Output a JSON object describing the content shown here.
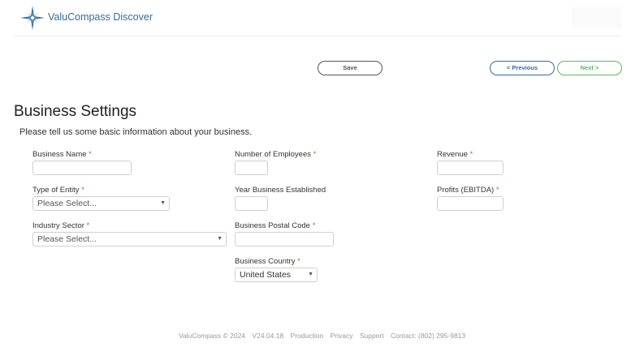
{
  "header": {
    "app_name": "ValuCompass Discover"
  },
  "toolbar": {
    "save_label": "Save",
    "previous_label": "< Previous",
    "next_label": "Next >"
  },
  "page": {
    "title": "Business Settings",
    "intro": "Please tell us some basic information about your business."
  },
  "required_marker": "*",
  "fields": {
    "business_name": {
      "label": "Business Name",
      "value": ""
    },
    "num_employees": {
      "label": "Number of Employees",
      "value": ""
    },
    "revenue": {
      "label": "Revenue",
      "value": ""
    },
    "entity_type": {
      "label": "Type of Entity",
      "value": "Please Select..."
    },
    "year_established": {
      "label": "Year Business Established",
      "value": ""
    },
    "profits": {
      "label": "Profits (EBITDA)",
      "value": ""
    },
    "industry_sector": {
      "label": "Industry Sector",
      "value": "Please Select..."
    },
    "postal_code": {
      "label": "Business Postal Code",
      "value": ""
    },
    "country": {
      "label": "Business Country",
      "value": "United States"
    }
  },
  "footer": {
    "copyright": "ValuCompass © 2024",
    "version": "V24.04.18",
    "environment": "Production",
    "privacy": "Privacy",
    "support": "Support",
    "contact": "Contact: (802) 295-9813"
  },
  "colors": {
    "brand": "#2e6da4",
    "next": "#5cb85c",
    "required": "#d9534f"
  },
  "icons": {
    "logo": "compass-star-icon",
    "select_arrow": "caret-down-icon"
  }
}
